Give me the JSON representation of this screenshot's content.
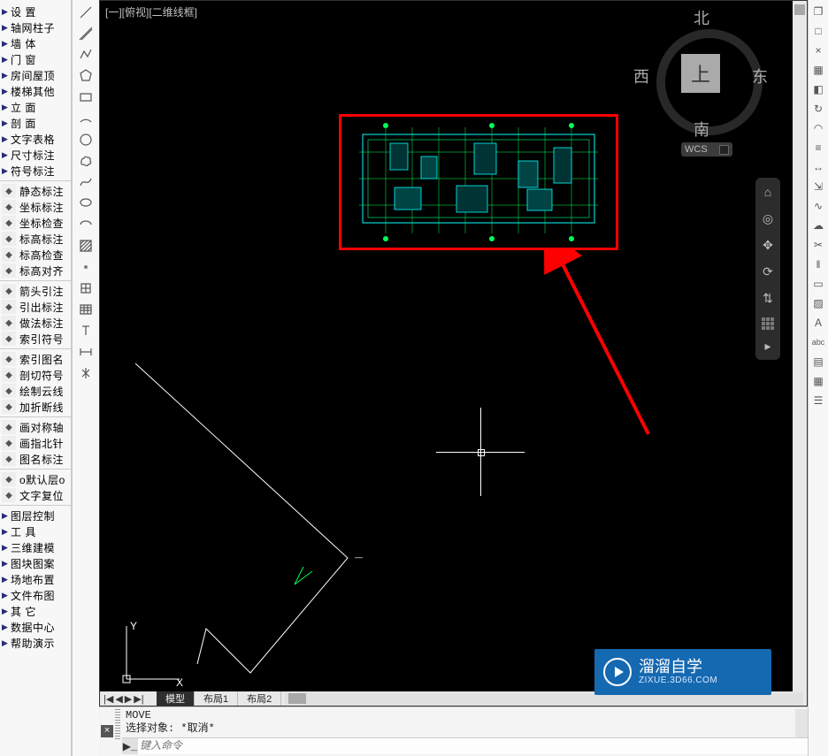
{
  "viewport_label": "[一][俯视][二维线框]",
  "left_groups": [
    {
      "items": [
        "设    置",
        "轴网柱子",
        "墙    体",
        "门    窗",
        "房间屋顶",
        "楼梯其他",
        "立    面",
        "剖    面",
        "文字表格",
        "尺寸标注",
        "符号标注"
      ],
      "arrow": true
    },
    {
      "items": [
        "静态标注",
        "坐标标注",
        "坐标检查",
        "标高标注",
        "标高检查",
        "标高对齐"
      ],
      "icon": true
    },
    {
      "items": [
        "箭头引注",
        "引出标注",
        "做法标注",
        "索引符号"
      ],
      "icon": true
    },
    {
      "items": [
        "索引图名",
        "剖切符号",
        "绘制云线",
        "加折断线"
      ],
      "icon": true
    },
    {
      "items": [
        "画对称轴",
        "画指北针",
        "图名标注"
      ],
      "icon": true
    },
    {
      "items": [
        "o默认层o",
        "文字复位"
      ],
      "icon": true
    },
    {
      "items": [
        "图层控制",
        "工    具",
        "三维建模",
        "图块图案",
        "场地布置",
        "文件布图",
        "其    它",
        "数据中心",
        "帮助演示"
      ],
      "arrow": true
    }
  ],
  "compass": {
    "n": "北",
    "s": "南",
    "e": "东",
    "w": "西",
    "center": "上"
  },
  "wcs_label": "WCS",
  "ucs": {
    "x": "X",
    "y": "Y"
  },
  "tabs": {
    "model": "模型",
    "layout1": "布局1",
    "layout2": "布局2"
  },
  "scroll_nav": {
    "first": "|◀",
    "prev": "◀",
    "next": "▶",
    "last": "▶|"
  },
  "command": {
    "line1": "MOVE",
    "line2": "选择对象: *取消*",
    "placeholder": "键入命令"
  },
  "close_glyph": "×",
  "prompt_glyph": "▶_",
  "watermark": {
    "title": "溜溜自学",
    "url": "ZIXUE.3D66.COM"
  },
  "tool_icons": [
    "line",
    "construction-line",
    "polyline",
    "polygon",
    "rectangle",
    "arc",
    "circle",
    "revision-cloud",
    "spline",
    "ellipse",
    "ellipse-arc",
    "hatch",
    "point",
    "block",
    "table",
    "text",
    "dimension",
    "mirror"
  ],
  "nav_icons": [
    "home",
    "wheel",
    "pan",
    "orbit",
    "show-motion"
  ],
  "right_icons": [
    "restore",
    "maximize",
    "close",
    "grid",
    "color",
    "cycle",
    "arc-opt",
    "segments",
    "dims",
    "extend",
    "curve",
    "cloud",
    "trim",
    "offset",
    "region",
    "hatch-r",
    "text-r",
    "abc",
    "field",
    "table-r",
    "layer"
  ],
  "chart_data": {
    "type": "table",
    "title": "CAD floor plan drawing highlighted inside red rectangle; schematic building plan with grid lines and internal partitions rendered in cyan/green on black. No numeric axis data."
  }
}
